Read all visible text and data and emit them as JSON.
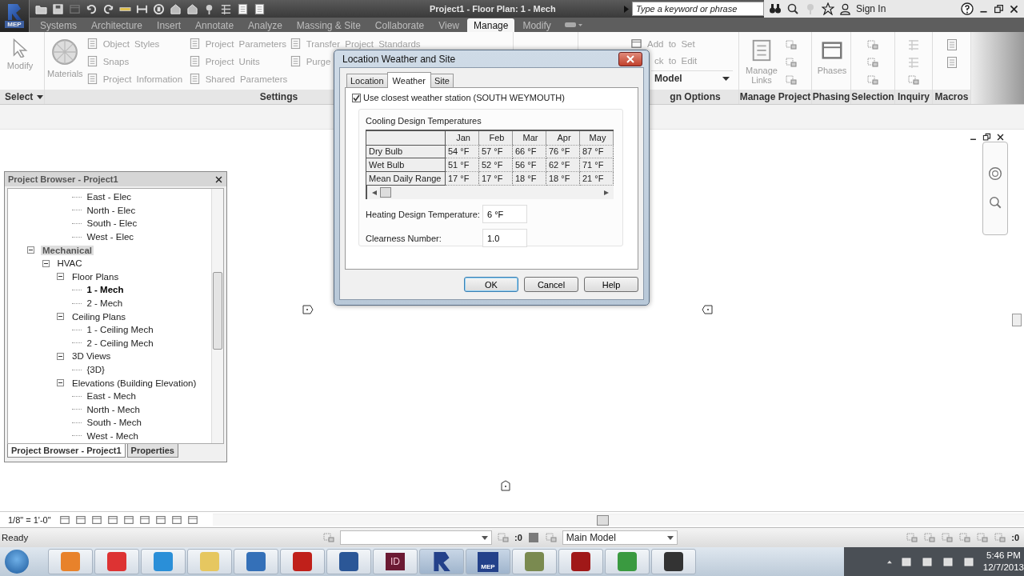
{
  "title_bar": {
    "app_badge": "MEP",
    "title": "Project1 - Floor Plan: 1 - Mech",
    "search": {
      "placeholder": "Type a keyword or phrase"
    },
    "sign_in": "Sign In"
  },
  "tabs": [
    {
      "label": "Systems",
      "selected": false
    },
    {
      "label": "Architecture",
      "selected": false
    },
    {
      "label": "Insert",
      "selected": false
    },
    {
      "label": "Annotate",
      "selected": false
    },
    {
      "label": "Analyze",
      "selected": false
    },
    {
      "label": "Massing & Site",
      "selected": false
    },
    {
      "label": "Collaborate",
      "selected": false
    },
    {
      "label": "View",
      "selected": false
    },
    {
      "label": "Manage",
      "selected": true
    },
    {
      "label": "Modify",
      "selected": false
    }
  ],
  "select_panel": {
    "title": "Select",
    "modify": "Modify"
  },
  "settings_panel": {
    "title": "Settings",
    "materials": "Materials",
    "columns": [
      [
        "Object Styles",
        "Snaps",
        "Project Information"
      ],
      [
        "Project Parameters",
        "Project Units",
        "Shared Parameters"
      ],
      [
        "Transfer Project Standards",
        "Purge"
      ]
    ]
  },
  "design_options_panel": {
    "title": "gn Options",
    "row_1": "Add to Set",
    "row_2": "ck to Edit",
    "option_set": "Model"
  },
  "manage_project_panel": {
    "title": "Manage Project",
    "manage_links": "Manage Links"
  },
  "phasing_panel": {
    "title": "Phasing",
    "phases": "Phases"
  },
  "selection_panel": {
    "title": "Selection"
  },
  "inquiry_panel": {
    "title": "Inquiry"
  },
  "macros_panel": {
    "title": "Macros"
  },
  "dialog": {
    "title": "Location Weather and Site",
    "tabs": [
      {
        "label": "Location",
        "selected": false
      },
      {
        "label": "Weather",
        "selected": true
      },
      {
        "label": "Site",
        "selected": false
      }
    ],
    "use_closest": {
      "label": "Use closest weather station (SOUTH WEYMOUTH)",
      "checked": true
    },
    "cooling": {
      "title": "Cooling Design Temperatures",
      "columns": [
        "Jan",
        "Feb",
        "Mar",
        "Apr",
        "May"
      ],
      "rows": [
        {
          "label": "Dry Bulb",
          "values": [
            "54 °F",
            "57 °F",
            "66 °F",
            "76 °F",
            "87 °F"
          ]
        },
        {
          "label": "Wet Bulb",
          "values": [
            "51 °F",
            "52 °F",
            "56 °F",
            "62 °F",
            "71 °F"
          ]
        },
        {
          "label": "Mean Daily Range",
          "values": [
            "17 °F",
            "17 °F",
            "18 °F",
            "18 °F",
            "21 °F"
          ]
        }
      ]
    },
    "fields": [
      {
        "label": "Heating Design Temperature:",
        "value": "6 °F"
      },
      {
        "label": "Clearness Number:",
        "value": "1.0"
      }
    ],
    "buttons": [
      {
        "label": "OK",
        "default": true
      },
      {
        "label": "Cancel",
        "default": false
      },
      {
        "label": "Help",
        "default": false
      }
    ]
  },
  "browser": {
    "title": "Project Browser - Project1",
    "leaves_above": [
      {
        "label": "East - Elec",
        "selected": false,
        "current": false
      },
      {
        "label": "North - Elec",
        "selected": false,
        "current": false
      },
      {
        "label": "South - Elec",
        "selected": false,
        "current": false
      },
      {
        "label": "West - Elec",
        "selected": false,
        "current": false
      }
    ],
    "tree": [
      {
        "label": "Mechanical",
        "selected": true,
        "current": false,
        "expanded": true,
        "children": [
          {
            "label": "HVAC",
            "selected": false,
            "current": false,
            "expanded": true,
            "children": [
              {
                "label": "Floor Plans",
                "selected": false,
                "current": false,
                "expanded": true,
                "children": [
                  {
                    "label": "1 - Mech",
                    "selected": false,
                    "current": true
                  },
                  {
                    "label": "2 - Mech",
                    "selected": false,
                    "current": false
                  }
                ]
              },
              {
                "label": "Ceiling Plans",
                "selected": false,
                "current": false,
                "expanded": true,
                "children": [
                  {
                    "label": "1 - Ceiling Mech",
                    "selected": false,
                    "current": false
                  },
                  {
                    "label": "2 - Ceiling Mech",
                    "selected": false,
                    "current": false
                  }
                ]
              },
              {
                "label": "3D Views",
                "selected": false,
                "current": false,
                "expanded": true,
                "children": [
                  {
                    "label": "{3D}",
                    "selected": false,
                    "current": false
                  }
                ]
              },
              {
                "label": "Elevations (Building Elevation)",
                "selected": false,
                "current": false,
                "expanded": true,
                "children": [
                  {
                    "label": "East - Mech",
                    "selected": false,
                    "current": false
                  },
                  {
                    "label": "North - Mech",
                    "selected": false,
                    "current": false
                  },
                  {
                    "label": "South - Mech",
                    "selected": false,
                    "current": false
                  },
                  {
                    "label": "West - Mech",
                    "selected": false,
                    "current": false
                  }
                ]
              }
            ]
          }
        ]
      }
    ],
    "tabs": [
      {
        "label": "Project Browser - Project1",
        "selected": true
      },
      {
        "label": "Properties",
        "selected": false
      }
    ]
  },
  "view_bar": {
    "scale": "1/8\" = 1'-0\""
  },
  "status_bar": {
    "text": "Ready",
    "selection_count": ":0",
    "workset": "Main Model",
    "filter_count": ":0"
  },
  "taskbar": {
    "indesign_letters": "ID",
    "revit_label": "MEP",
    "time": "5:46 PM",
    "date": "12/7/2013"
  }
}
